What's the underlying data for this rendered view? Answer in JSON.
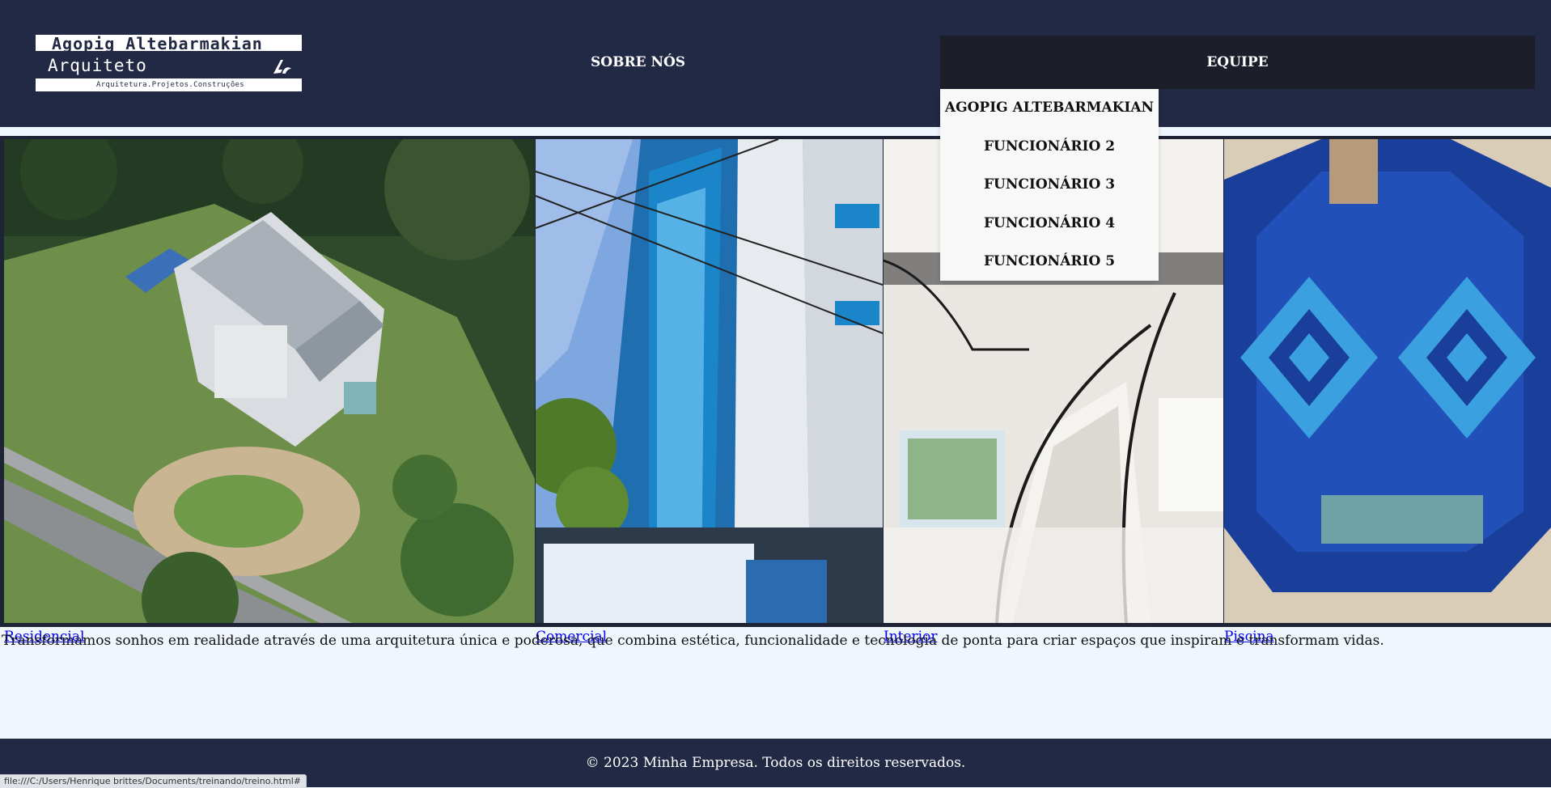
{
  "header": {
    "logo": {
      "name": "Agopig Altebarmakian",
      "title": "Arquiteto",
      "tagline": "Arquitetura.Projetos.Construções"
    },
    "nav": [
      {
        "label": "SOBRE NÓS"
      },
      {
        "label": "EQUIPE"
      }
    ],
    "team_dropdown": [
      {
        "label": "AGOPIG ALTEBARMAKIAN"
      },
      {
        "label": "FUNCIONÁRIO 2"
      },
      {
        "label": "FUNCIONÁRIO 3"
      },
      {
        "label": "FUNCIONÁRIO 4"
      },
      {
        "label": "FUNCIONÁRIO 5"
      }
    ]
  },
  "gallery": [
    {
      "caption": "Residencial"
    },
    {
      "caption": "Comercial"
    },
    {
      "caption": "Interior"
    },
    {
      "caption": "Piscina"
    }
  ],
  "intro": "Transformamos sonhos em realidade através de uma arquitetura única e poderosa, que combina estética, funcionalidade e tecnologia de ponta para criar espaços que inspiram e transformam vidas.",
  "footer": {
    "copyright": "© 2023 Minha Empresa. Todos os direitos reservados."
  },
  "statusbar": {
    "url": "file:///C:/Users/Henrique brittes/Documents/treinando/treino.html#"
  },
  "colors": {
    "header_bg": "#222944",
    "page_bg": "#f0f6fe",
    "link": "#0000ee",
    "dropdown_bg": "#f8f8f8"
  }
}
